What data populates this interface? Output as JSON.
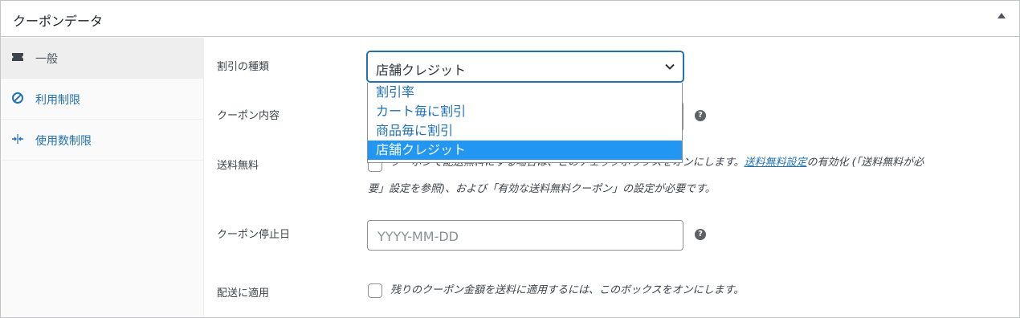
{
  "panel": {
    "title": "クーポンデータ",
    "collapse_icon": "triangle-up-icon"
  },
  "sidebar": {
    "items": [
      {
        "label": "一般",
        "icon": "ticket-icon",
        "active": true
      },
      {
        "label": "利用制限",
        "icon": "block-icon",
        "active": false
      },
      {
        "label": "使用数制限",
        "icon": "arrows-in-icon",
        "active": false
      }
    ]
  },
  "fields": {
    "discount_type": {
      "label": "割引の種類",
      "value": "店舗クレジット",
      "options": [
        "割引率",
        "カート毎に割引",
        "商品毎に割引",
        "店舗クレジット"
      ]
    },
    "coupon_amount": {
      "label": "クーポン内容",
      "help": "?"
    },
    "free_shipping": {
      "label": "送料無料",
      "line1_pre": "クーポンで配送無料にする場合は、このチェックボックスをオンにします。",
      "link": "送料無料設定",
      "line1_post": "の有効化 (「送料無料が必",
      "line2": "要」設定を参照)、および「有効な送料無料クーポン」の設定が必要です。"
    },
    "expiry_date": {
      "label": "クーポン停止日",
      "placeholder": "YYYY-MM-DD",
      "value": "",
      "help": "?"
    },
    "apply_shipping": {
      "label": "配送に適用",
      "description": "残りのクーポン金額を送料に適用するには、このボックスをオンにします。"
    }
  },
  "colors": {
    "accent": "#2271b1",
    "selected_option_bg": "#2196f3",
    "border": "#c3c4c7"
  }
}
